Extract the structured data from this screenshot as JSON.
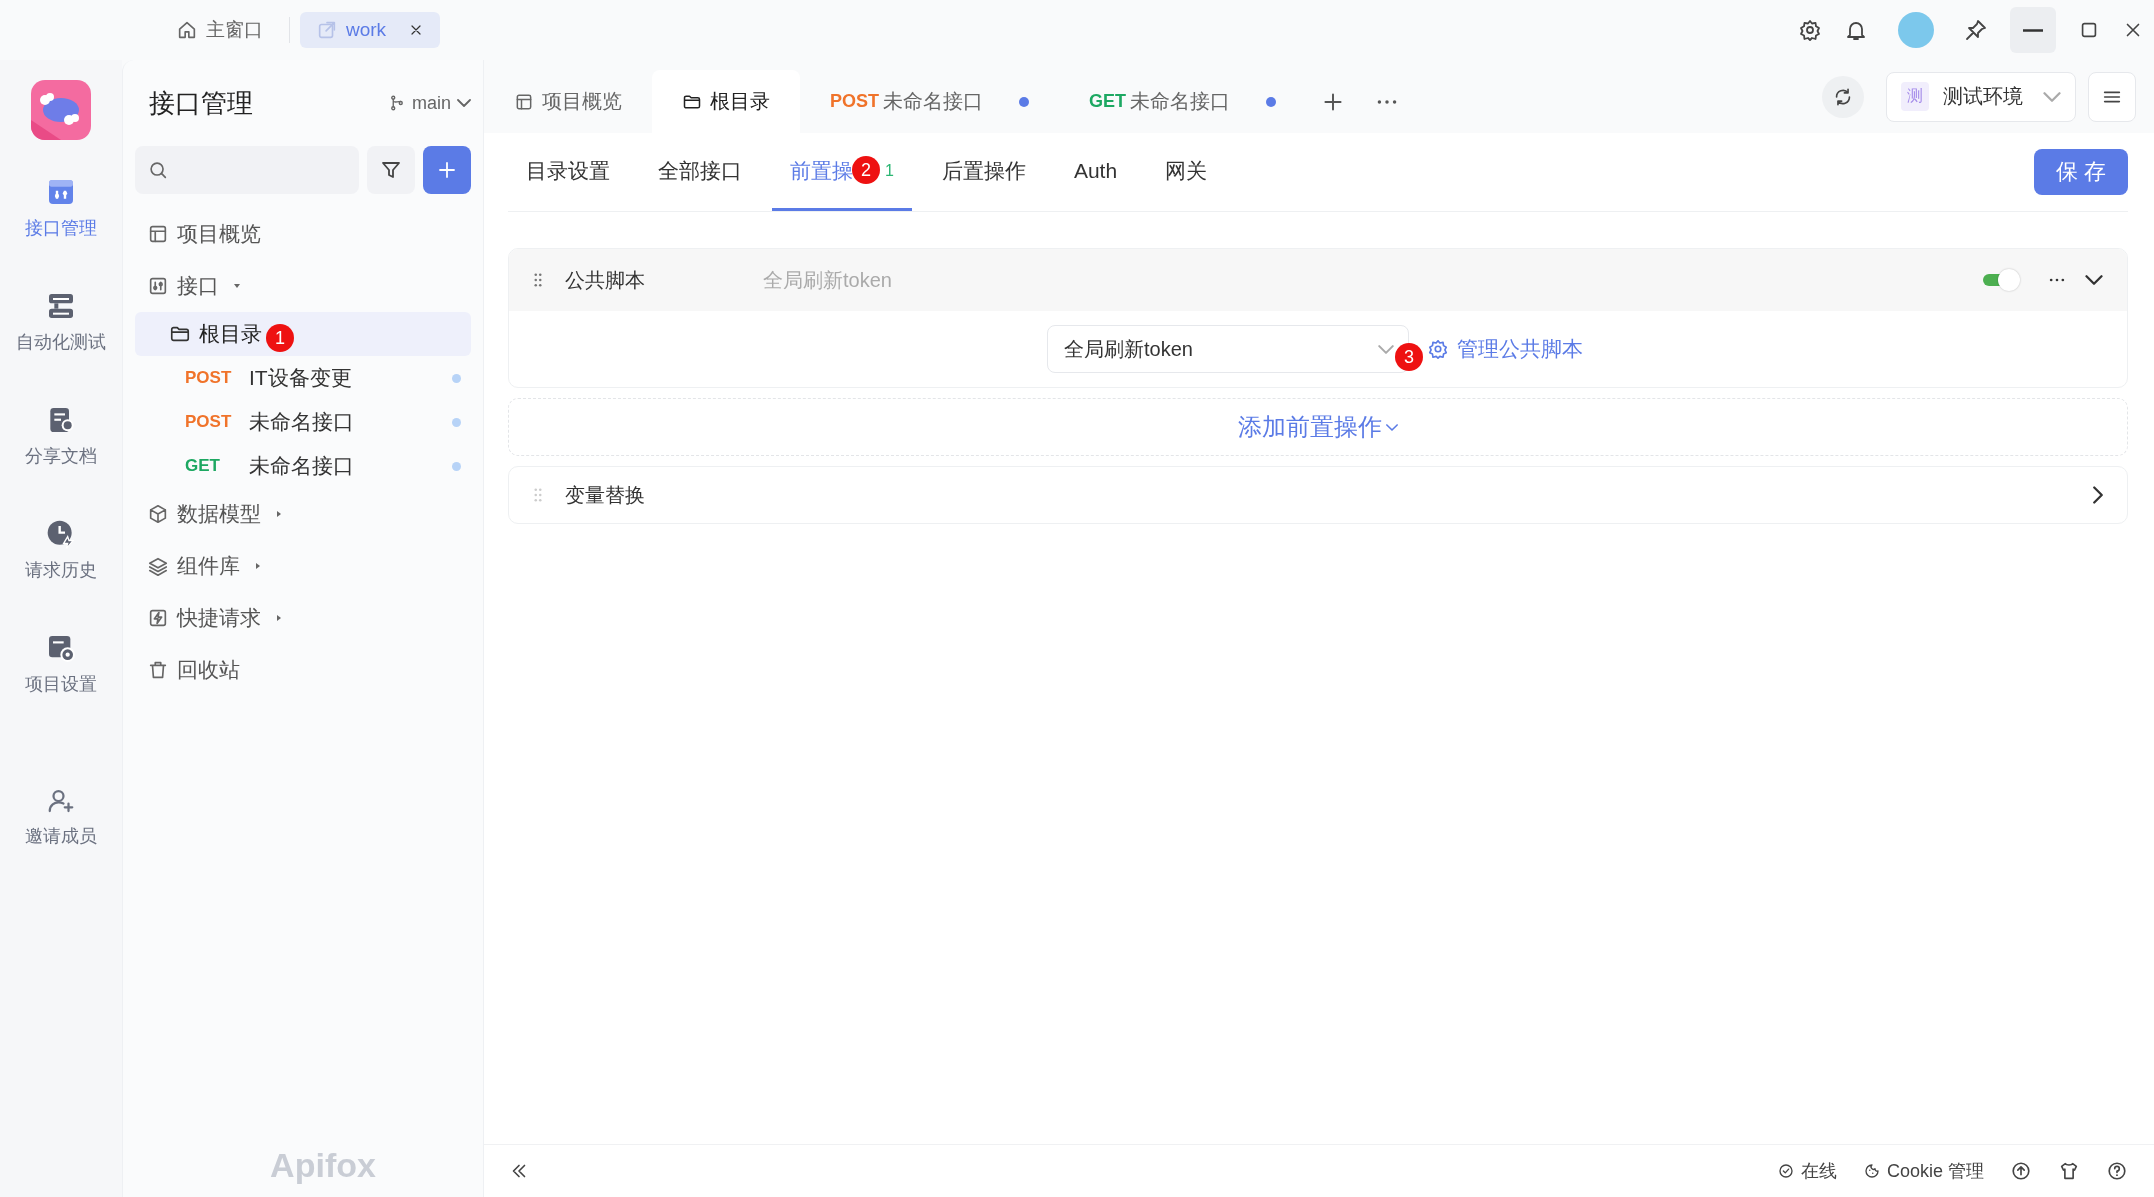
{
  "window_tabs": [
    {
      "label": "主窗口",
      "selected": false,
      "closable": false
    },
    {
      "label": "work",
      "selected": true,
      "closable": true
    }
  ],
  "nav_rail": [
    {
      "label": "接口管理",
      "selected": true
    },
    {
      "label": "自动化测试",
      "selected": false
    },
    {
      "label": "分享文档",
      "selected": false
    },
    {
      "label": "请求历史",
      "selected": false
    },
    {
      "label": "项目设置",
      "selected": false
    },
    {
      "label": "邀请成员",
      "selected": false
    }
  ],
  "sidebar": {
    "title": "接口管理",
    "branch": "main",
    "tree": [
      {
        "label": "项目概览"
      },
      {
        "label": "接口",
        "expanded": true,
        "children": [
          {
            "label": "根目录",
            "selected": true,
            "marker": "1",
            "children": [
              {
                "method": "POST",
                "label": "IT设备变更",
                "unsaved": true
              },
              {
                "method": "POST",
                "label": "未命名接口",
                "unsaved": true
              },
              {
                "method": "GET",
                "label": "未命名接口",
                "unsaved": true
              }
            ]
          }
        ]
      },
      {
        "label": "数据模型",
        "expanded": false
      },
      {
        "label": "组件库",
        "expanded": false
      },
      {
        "label": "快捷请求",
        "expanded": false
      },
      {
        "label": "回收站"
      }
    ],
    "brand": "Apifox"
  },
  "open_tabs": [
    {
      "label": "项目概览",
      "selected": false
    },
    {
      "label": "根目录",
      "selected": true
    },
    {
      "method": "POST",
      "label": "未命名接口",
      "selected": false,
      "unsaved": true
    },
    {
      "method": "GET",
      "label": "未命名接口",
      "selected": false,
      "unsaved": true
    }
  ],
  "environment": {
    "badge": "测",
    "name": "测试环境"
  },
  "sub_tabs": [
    {
      "label": "目录设置",
      "selected": false
    },
    {
      "label": "全部接口",
      "selected": false
    },
    {
      "label": "前置操",
      "selected": true,
      "marker": "2",
      "count": "1"
    },
    {
      "label": "后置操作",
      "selected": false
    },
    {
      "label": "Auth",
      "selected": false
    },
    {
      "label": "网关",
      "selected": false
    }
  ],
  "save_button": "保 存",
  "operations": [
    {
      "kind": "script",
      "title": "公共脚本",
      "summary": "全局刷新token",
      "enabled": true,
      "expanded": true,
      "select_value": "全局刷新token",
      "marker": "3",
      "manage_link": "管理公共脚本"
    },
    {
      "kind": "add",
      "label": "添加前置操作"
    },
    {
      "kind": "variable",
      "title": "变量替换",
      "expanded": false
    }
  ],
  "status_bar": {
    "online": "在线",
    "cookie": "Cookie 管理"
  }
}
